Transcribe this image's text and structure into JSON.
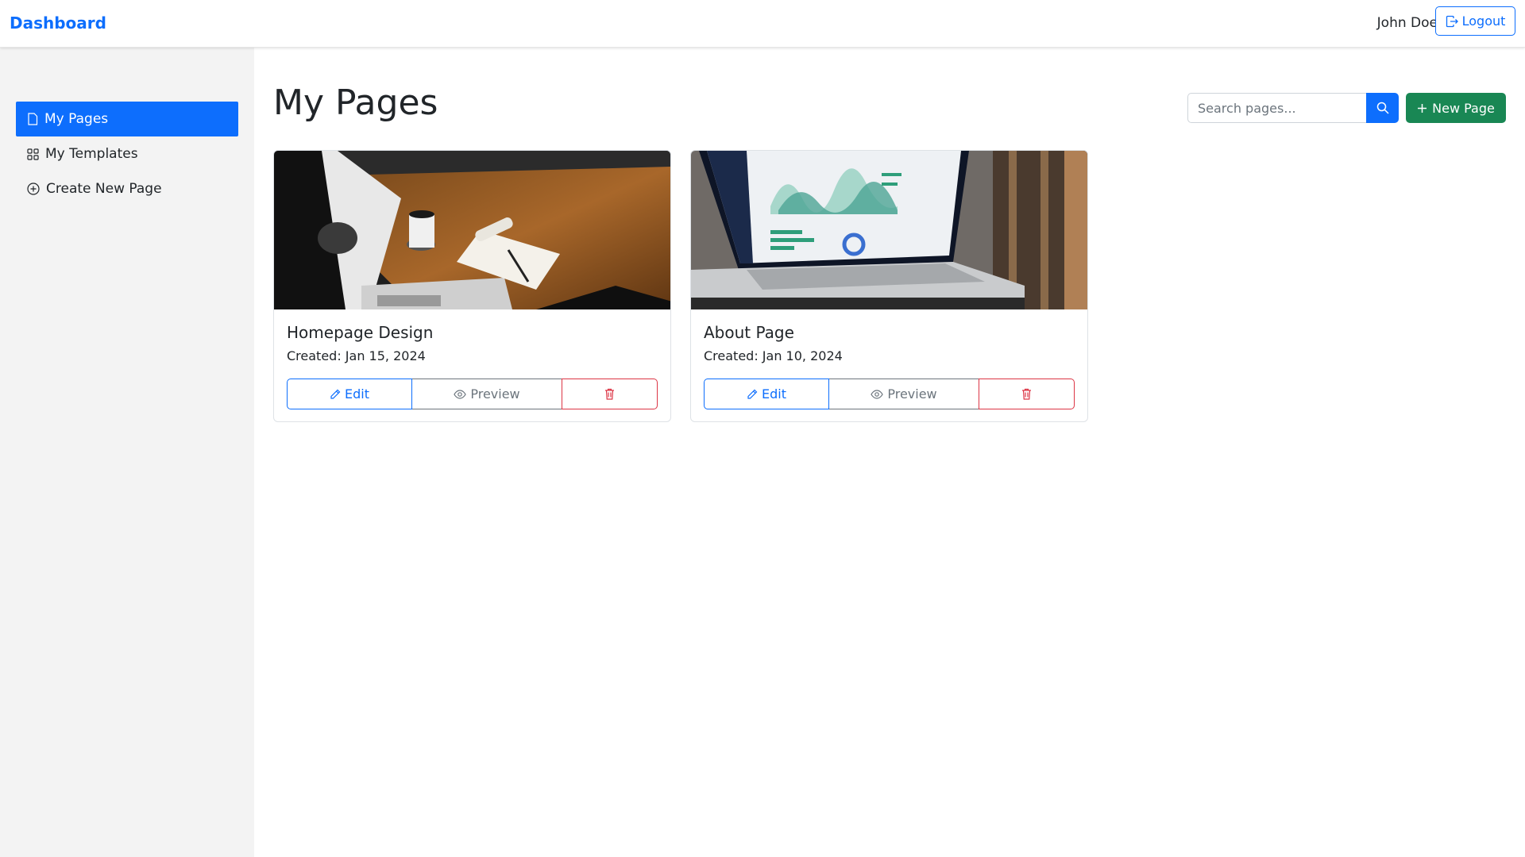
{
  "navbar": {
    "brand": "Dashboard",
    "user_name": "John Doe",
    "logout_label": "Logout"
  },
  "sidebar": {
    "items": [
      {
        "label": "My Pages",
        "icon": "file-icon",
        "active": true
      },
      {
        "label": "My Templates",
        "icon": "grid-icon",
        "active": false
      },
      {
        "label": "Create New Page",
        "icon": "plus-circle-icon",
        "active": false
      }
    ]
  },
  "main": {
    "title": "My Pages",
    "search_placeholder": "Search pages...",
    "new_page_label": "New Page"
  },
  "cards": [
    {
      "title": "Homepage Design",
      "created": "Created: Jan 15, 2024",
      "image": "desk-with-coffee-and-notepad-photo",
      "edit_label": "Edit",
      "preview_label": "Preview"
    },
    {
      "title": "About Page",
      "created": "Created: Jan 10, 2024",
      "image": "laptop-with-analytics-dashboard-photo",
      "edit_label": "Edit",
      "preview_label": "Preview"
    }
  ],
  "colors": {
    "primary": "#0d6efd",
    "success": "#198754",
    "danger": "#dc3545",
    "secondary": "#6c757d",
    "sidebar_bg": "#f3f3f3"
  }
}
